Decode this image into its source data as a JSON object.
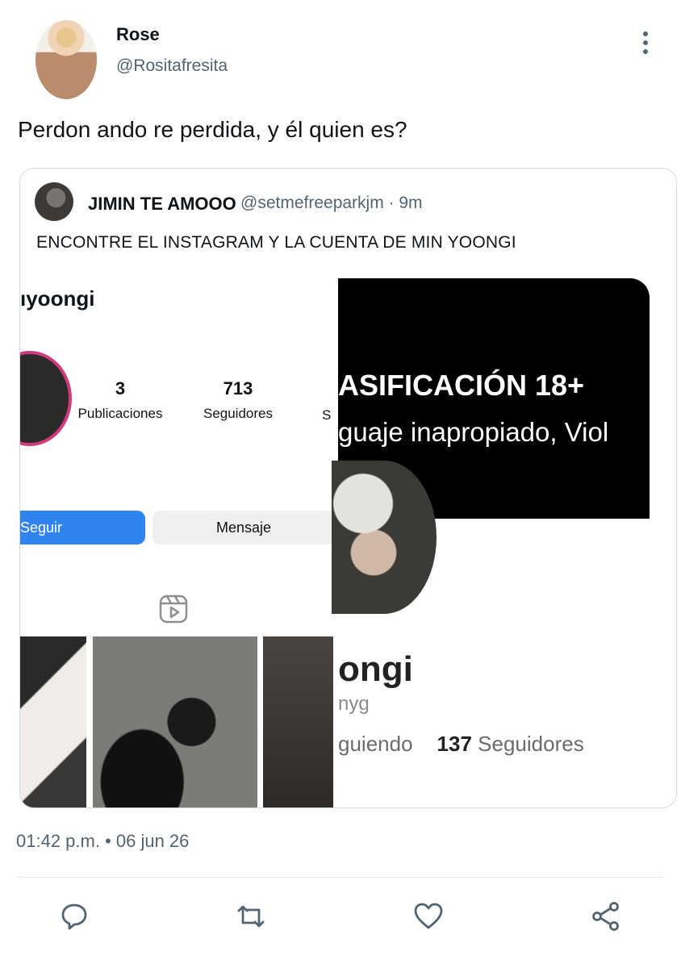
{
  "author": {
    "name": "Rose",
    "handle": "@Rositafresita"
  },
  "tweet": {
    "text": "Perdon ando re perdida, y él quien es?"
  },
  "quote": {
    "name": "JIMIN TE AMOOO",
    "handle_time": "@setmefreeparkjm · 9m",
    "text": "ENCONTRE EL INSTAGRAM Y LA CUENTA DE MIN YOONGI",
    "left_screenshot": {
      "username": "ıyoongi",
      "posts_count": "3",
      "posts_label": "Publicaciones",
      "followers_count": "713",
      "followers_label": "Seguidores",
      "third_stat_cut": "S",
      "follow_label": "Seguir",
      "message_label": "Mensaje"
    },
    "right_screenshot": {
      "banner_line1": "ASIFICACIÓN 18+",
      "banner_line2": "guaje inapropiado, Viol",
      "name": "ongi",
      "handle": "nyg",
      "following_label": "guiendo",
      "followers_count": "137",
      "followers_label": "Seguidores"
    }
  },
  "timestamp": "01:42 p.m. • 06 jun 26",
  "actions": [
    "reply-icon",
    "retweet-icon",
    "like-icon",
    "share-icon"
  ]
}
